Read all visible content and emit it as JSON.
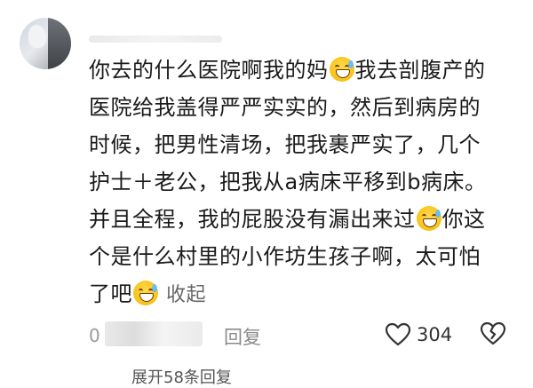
{
  "comment": {
    "lines": [
      {
        "text": "你去的什么医院啊我的妈",
        "emoji": "laughing-tears-emoji",
        "text_after": "我去剖腹产的"
      },
      {
        "text": "医院给我盖得严严实实的，然后到病房的"
      },
      {
        "text": "时候，把男性清场，把我裹严实了，几个"
      },
      {
        "text": "护士＋老公，把我从a病床平移到b病床。"
      },
      {
        "text": "并且全程，我的屁股没有漏出来过",
        "emoji": "grinning-sweat-emoji",
        "text_after": "你这"
      },
      {
        "text": "个是什么村里的小作坊生孩子啊，太可怕"
      },
      {
        "text": "了吧",
        "emoji": "grinning-sweat-emoji",
        "text_after": ""
      }
    ],
    "collapse_label": "收起"
  },
  "footer": {
    "date_partial": "0",
    "reply_label": "回复",
    "like_count": "304",
    "like_icon": "heart-outline-icon",
    "dislike_icon": "broken-heart-icon"
  },
  "expand_label": "展开58条回复",
  "colors": {
    "text": "#1a1a1a",
    "muted": "#8a8a8a",
    "emoji": "#f5b800"
  }
}
